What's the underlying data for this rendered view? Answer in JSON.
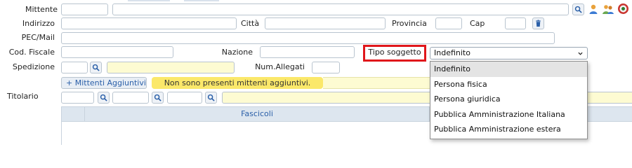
{
  "labels": {
    "mittente": "Mittente",
    "indirizzo": "Indirizzo",
    "citta": "Città",
    "provincia": "Provincia",
    "cap": "Cap",
    "pec": "PEC/Mail",
    "cod_fiscale": "Cod. Fiscale",
    "nazione": "Nazione",
    "tipo_soggetto": "Tipo soggetto",
    "spedizione": "Spedizione",
    "num_allegati": "Num.Allegati",
    "titolario": "Titolario"
  },
  "tipo_soggetto": {
    "selected": "Indefinito",
    "options": [
      "Indefinito",
      "Persona fisica",
      "Persona giuridica",
      "Pubblica Amministrazione Italiana",
      "Pubblica Amministrazione estera"
    ]
  },
  "mittenti": {
    "button_label": "+ Mittenti Aggiuntivi",
    "notice": "Non sono presenti mittenti aggiuntivi."
  },
  "grid": {
    "header": "Fascicoli"
  },
  "icons": {
    "search": "magnifier-icon",
    "user": "user-icon",
    "users": "users-group-icon",
    "registry": "registry-icon",
    "trash": "trash-icon"
  },
  "colors": {
    "highlight": "#e0161b",
    "notice_bg": "#fbe86a",
    "accent": "#2a5fa8"
  }
}
